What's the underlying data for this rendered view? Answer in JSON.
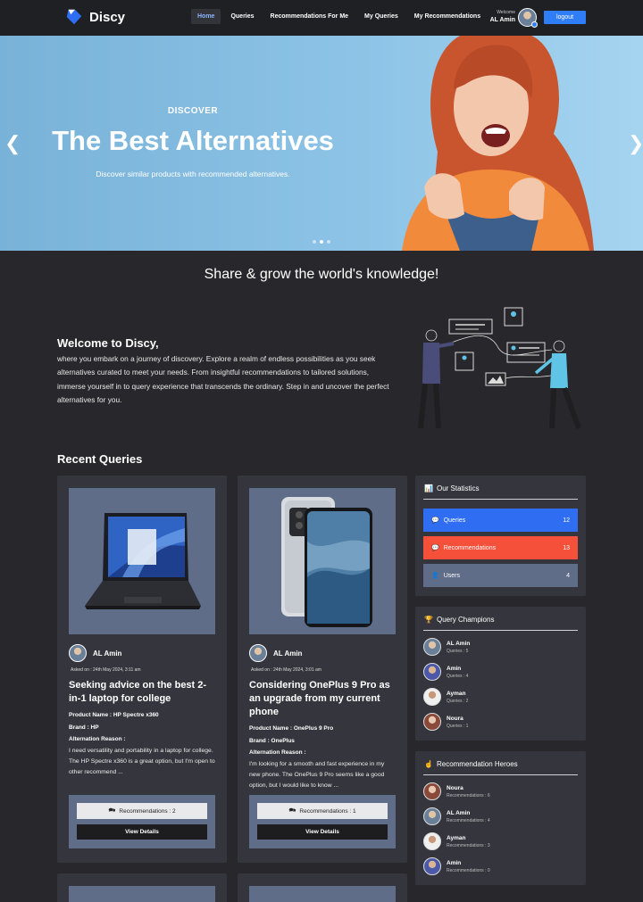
{
  "nav": {
    "brand": "Discy",
    "links": [
      "Home",
      "Queries",
      "Recommendations For Me",
      "My Queries",
      "My Recommendations"
    ],
    "welcome_label": "Welcome",
    "user_name": "AL Amin",
    "logout_label": "logout"
  },
  "hero": {
    "kicker": "DISCOVER",
    "title": "The Best Alternatives",
    "subtitle": "Discover similar products with recommended alternatives.",
    "prev_icon": "chevron-left-icon",
    "next_icon": "chevron-right-icon"
  },
  "tagline": "Share & grow the world's knowledge!",
  "welcome": {
    "title": "Welcome to Discy,",
    "text": "where you embark on a journey of discovery. Explore a realm of endless possibilities as you seek alternatives curated to meet your needs. From insightful recommendations to tailored solutions, immerse yourself in to query experience that transcends the ordinary. Step in and uncover the perfect alternatives for you."
  },
  "recent": {
    "title": "Recent Queries",
    "cards": [
      {
        "author": "AL Amin",
        "asked": "Asked on : 24th May 2024, 3:11 am",
        "title": "Seeking advice on the best 2-in-1 laptop for college",
        "product": "Product Name : HP Spectre x360",
        "brand": "Brand : HP",
        "reason_label": "Alternation Reason :",
        "reason": "I need versatility and portability in a laptop for college. The HP Spectre x360 is a great option, but I'm open to other recommend ...",
        "recommendations": "Recommendations : 2",
        "view": "View Details"
      },
      {
        "author": "AL Amin",
        "asked": "Asked on : 24th May 2024, 3:01 am",
        "title": "Considering OnePlus 9 Pro as an upgrade from my current phone",
        "product": "Product Name : OnePlus 9 Pro",
        "brand": "Brand : OnePlus",
        "reason_label": "Alternation Reason :",
        "reason": "I'm looking for a smooth and fast experience in my new phone. The OnePlus 9 Pro seems like a good option, but I would like to know ...",
        "recommendations": "Recommendations : 1",
        "view": "View Details"
      }
    ]
  },
  "stats": {
    "title": "Our Statistics",
    "items": [
      {
        "label": "Queries",
        "value": "12",
        "color": "#2f6ef3",
        "icon": "chat-icon"
      },
      {
        "label": "Recommendations",
        "value": "13",
        "color": "#f4503a",
        "icon": "chat-icon"
      },
      {
        "label": "Users",
        "value": "4",
        "color": "#5f6d89",
        "icon": "user-icon"
      }
    ]
  },
  "champions": {
    "title": "Query Champions",
    "people": [
      {
        "name": "AL Amin",
        "count": "Queries : 5"
      },
      {
        "name": "Amin",
        "count": "Queries : 4"
      },
      {
        "name": "Ayman",
        "count": "Queries : 2"
      },
      {
        "name": "Noura",
        "count": "Queries : 1"
      }
    ]
  },
  "heroes": {
    "title": "Recommendation Heroes",
    "people": [
      {
        "name": "Noura",
        "count": "Recommendations : 6"
      },
      {
        "name": "AL Amin",
        "count": "Recommendations : 4"
      },
      {
        "name": "Ayman",
        "count": "Recommendations : 3"
      },
      {
        "name": "Amin",
        "count": "Recommendations : 0"
      }
    ]
  }
}
